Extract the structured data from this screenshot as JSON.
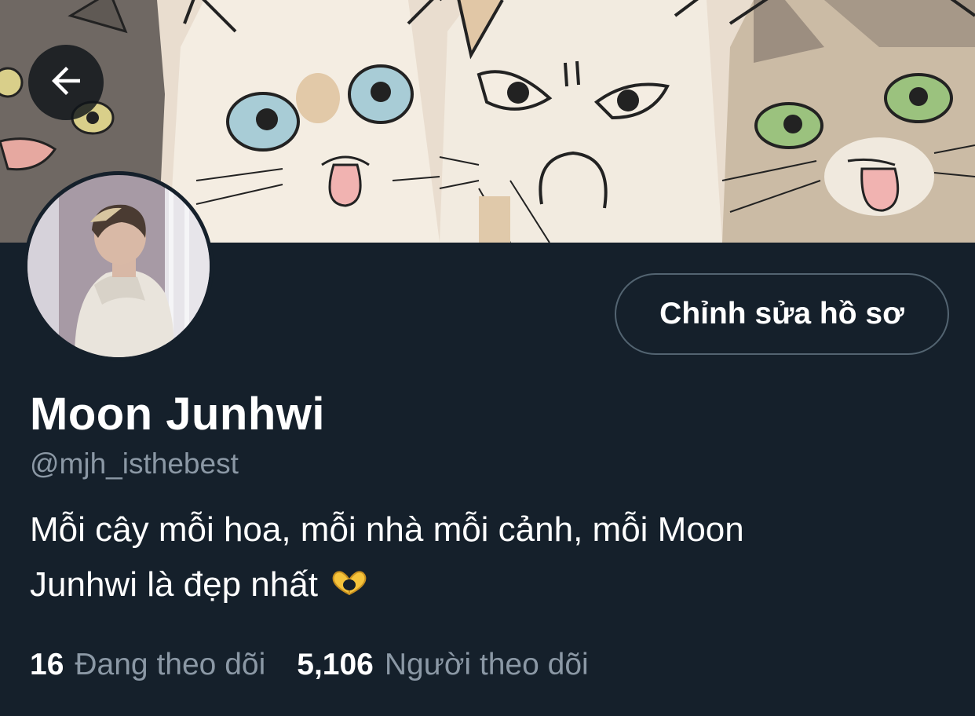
{
  "header": {
    "back_icon": "arrow-left-icon",
    "banner_image": "illustrated-cats-banner"
  },
  "profile": {
    "avatar_image": "profile-photo",
    "edit_button_label": "Chỉnh sửa hồ sơ",
    "display_name": "Moon Junhwi",
    "handle": "@mjh_isthebest",
    "bio_line1": "Mỗi cây mỗi hoa, mỗi nhà mỗi cảnh, mỗi Moon",
    "bio_line2": "Junhwi là đẹp nhất",
    "bio_emoji": "heart-hands-emoji"
  },
  "stats": {
    "following_count": "16",
    "following_label": "Đang theo dõi",
    "followers_count": "5,106",
    "followers_label": "Người theo dõi"
  },
  "colors": {
    "background": "#15202b",
    "secondary_text": "#8b98a5",
    "button_border": "#536471"
  }
}
